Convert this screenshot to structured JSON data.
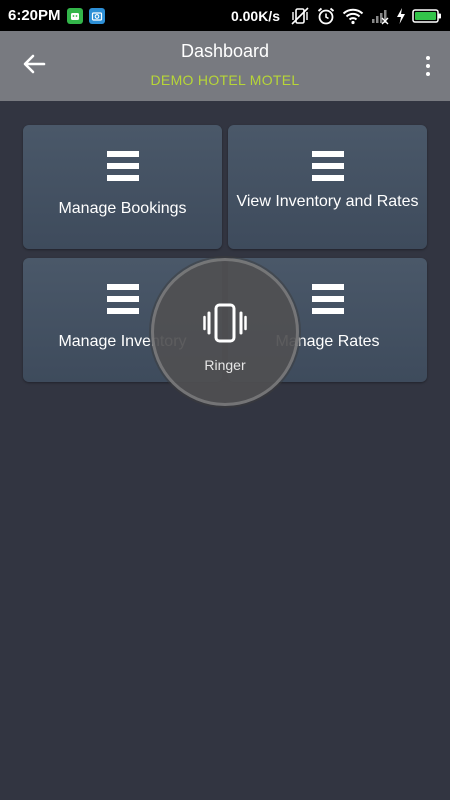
{
  "status_bar": {
    "time": "6:20PM",
    "speed": "0.00K/s",
    "icons": [
      "android-app-icon",
      "camera-app-icon",
      "vibrate-icon",
      "alarm-icon",
      "wifi-icon",
      "signal-icon",
      "charging-icon",
      "battery-icon"
    ]
  },
  "header": {
    "title": "Dashboard",
    "subtitle": "DEMO HOTEL MOTEL",
    "back_icon": "arrow-left-icon",
    "menu_icon": "more-vertical-icon"
  },
  "tiles": [
    {
      "label": "Manage Bookings",
      "icon": "menu-icon"
    },
    {
      "label": "View Inventory and Rates",
      "icon": "menu-icon"
    },
    {
      "label": "Manage Inventory",
      "icon": "menu-icon"
    },
    {
      "label": "Manage Rates",
      "icon": "menu-icon"
    }
  ],
  "ringer_overlay": {
    "label": "Ringer",
    "icon": "vibrate-phone-icon"
  },
  "colors": {
    "background": "#323541",
    "app_bar": "#787a80",
    "subtitle": "#b7d637",
    "tile": "#45536a"
  }
}
